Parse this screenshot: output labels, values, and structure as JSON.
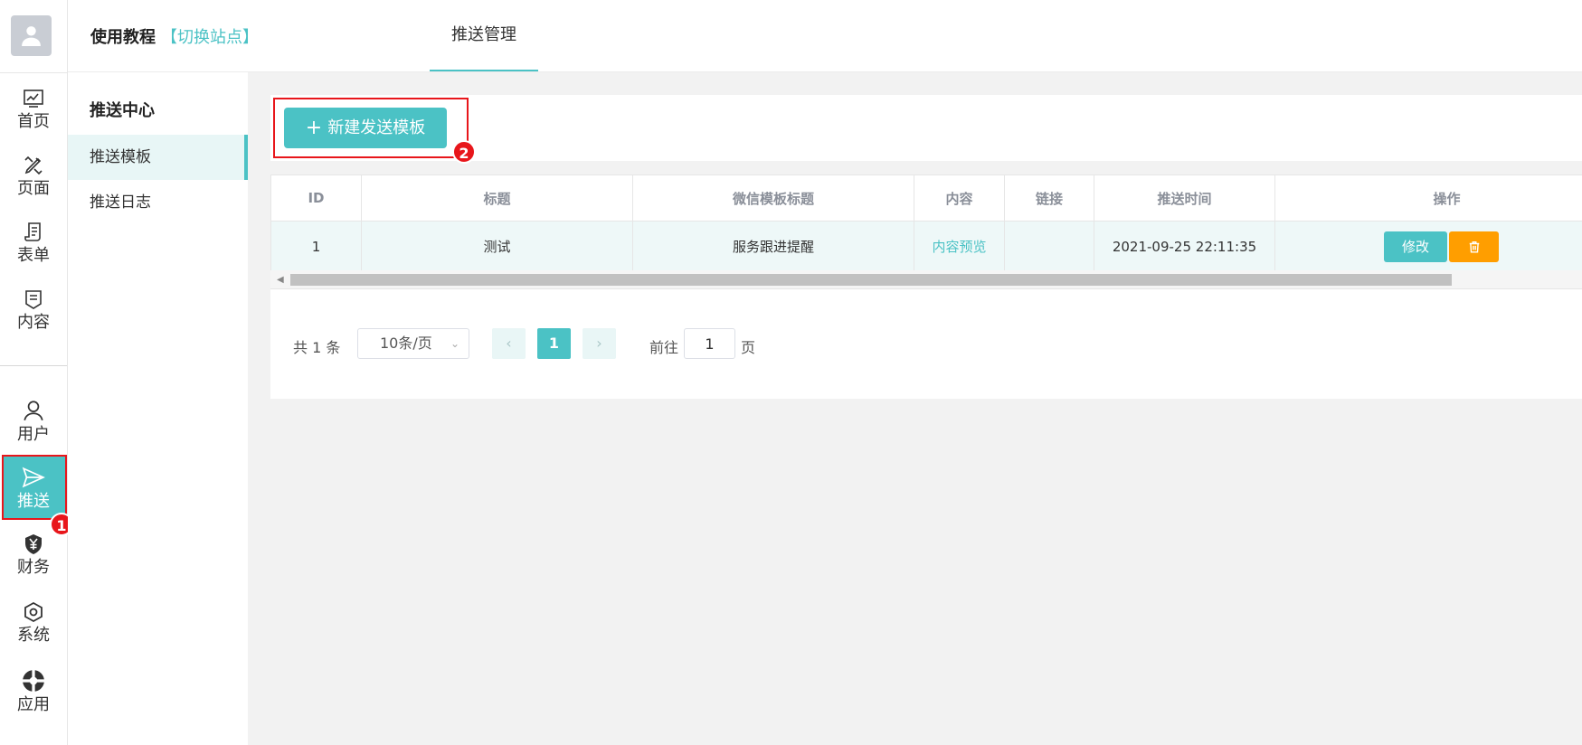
{
  "rail": {
    "items": [
      {
        "label": "首页",
        "icon": "chart-icon"
      },
      {
        "label": "页面",
        "icon": "design-icon"
      },
      {
        "label": "表单",
        "icon": "form-icon"
      },
      {
        "label": "内容",
        "icon": "content-icon"
      },
      {
        "label": "用户",
        "icon": "user-icon"
      },
      {
        "label": "推送",
        "icon": "send-icon",
        "active": true
      },
      {
        "label": "财务",
        "icon": "finance-icon"
      },
      {
        "label": "系统",
        "icon": "settings-icon"
      },
      {
        "label": "应用",
        "icon": "apps-icon"
      }
    ]
  },
  "topbar": {
    "brand": "使用教程",
    "switch_site": "【切换站点】",
    "tab": "推送管理"
  },
  "subside": {
    "title": "推送中心",
    "items": [
      "推送模板",
      "推送日志"
    ]
  },
  "toolbar": {
    "new_button": "新建发送模板"
  },
  "table": {
    "columns": [
      "ID",
      "标题",
      "微信模板标题",
      "内容",
      "链接",
      "推送时间",
      "操作"
    ],
    "rows": [
      {
        "id": "1",
        "title": "测试",
        "wx_title": "服务跟进提醒",
        "content": "内容预览",
        "link": "",
        "time": "2021-09-25 22:11:35",
        "edit": "修改"
      }
    ]
  },
  "pager": {
    "total": "共 1 条",
    "page_size": "10条/页",
    "current": "1",
    "goto_label": "前往",
    "goto_value": "1",
    "goto_suffix": "页"
  },
  "annotations": [
    "1",
    "2"
  ],
  "colors": {
    "accent": "#4bc2c5",
    "warning": "#ff9e00",
    "annotation": "#e8161b"
  }
}
